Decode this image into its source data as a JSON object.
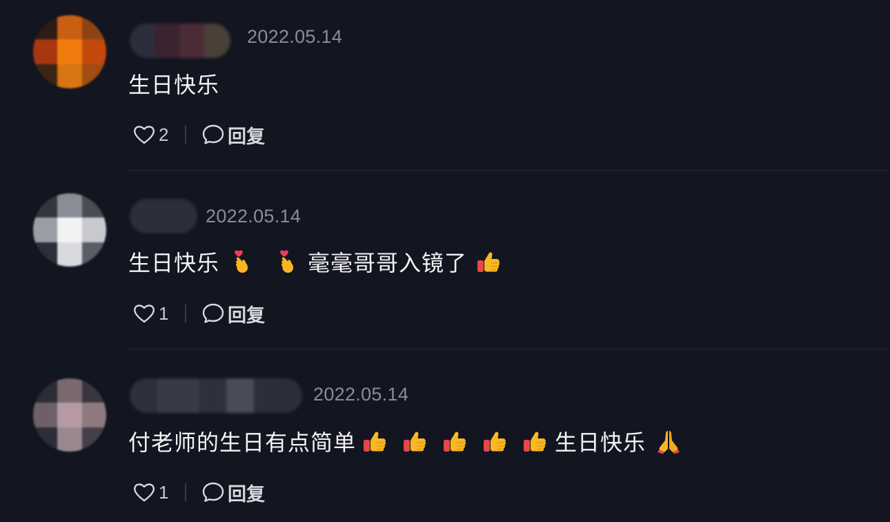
{
  "comments": [
    {
      "timestamp": "2022.05.14",
      "text_1": "生日快乐",
      "likes": "2",
      "reply_label": "回复"
    },
    {
      "timestamp": "2022.05.14",
      "text_1": "生日快乐",
      "text_2": "毫毫哥哥入镜了",
      "likes": "1",
      "reply_label": "回复"
    },
    {
      "timestamp": "2022.05.14",
      "text_1": "付老师的生日有点简单",
      "text_2": "生日快乐",
      "likes": "1",
      "reply_label": "回复"
    }
  ],
  "icons": {
    "like": "heart-outline-icon",
    "reply": "speech-bubble-icon",
    "emoji_heart_hand": "finger-heart-emoji",
    "emoji_thumbs": "thumbs-up-emoji",
    "emoji_pray": "folded-hands-emoji"
  },
  "colors": {
    "background": "#131520",
    "timestamp": "#8a8c96",
    "text": "#f4f4f6"
  }
}
